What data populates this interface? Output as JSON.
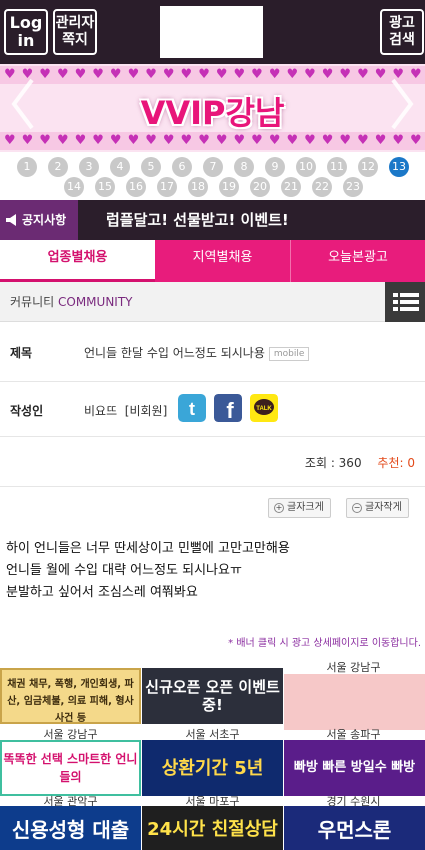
{
  "header": {
    "login_label": "Log\nin",
    "admin_label": "관리자\n쪽지",
    "search_label": "광고\n검색"
  },
  "banner": {
    "title": "VVIP강남",
    "heart_icon": "heart-icon"
  },
  "pagination": {
    "pages": [
      "1",
      "2",
      "3",
      "4",
      "5",
      "6",
      "7",
      "8",
      "9",
      "10",
      "11",
      "12",
      "13",
      "14",
      "15",
      "16",
      "17",
      "18",
      "19",
      "20",
      "21",
      "22",
      "23"
    ],
    "active": "13"
  },
  "notice": {
    "label": "공지사항",
    "text": "럽플달고! 선물받고! 이벤트!"
  },
  "tabs": [
    "업종별채용",
    "지역별채용",
    "오늘본광고"
  ],
  "community": {
    "title_ko": "커뮤니티",
    "title_en": "COMMUNITY"
  },
  "post": {
    "subject_label": "제목",
    "subject": "언니들 한달 수입 어느정도 되시나용",
    "mobile_badge": "mobile",
    "author_label": "작성인",
    "author": "비요뜨",
    "author_type": "[비회원]",
    "views_label": "조회 : 360",
    "recommend_label": "추천: 0",
    "font_larger": "글자크게",
    "font_smaller": "글자작게",
    "body_lines": [
      "하이 언니들은 너무 딴세상이고 민뻘에 고만고만해용",
      "언니들 월에 수입 대략 어느정도 되시나요ㅠ",
      "분발하고 싶어서 조심스레 여쭤봐요"
    ]
  },
  "banner_note": "* 배너 클릭 시 광고 상세페이지로 이동합니다.",
  "ads": {
    "captions_row0": [
      "",
      "",
      "서울 강남구"
    ],
    "row1": [
      {
        "text": "채권 채무, 폭행, 개인회생, 파산, 임금체불, 의료 피해, 형사사건 등",
        "bg": "#f4d98a"
      },
      {
        "text": "신규오픈 오픈 이벤트중!",
        "bg": "#2c2f3b"
      },
      {
        "text": "",
        "bg": "#f6c8c8"
      }
    ],
    "captions_row1": [
      "서울 강남구",
      "서울 서초구",
      "서울 송파구"
    ],
    "row2": [
      {
        "text": "똑똑한 선택 스마트한 언니들의",
        "bg": "#ffffff"
      },
      {
        "text": "상환기간 5년",
        "bg": "#0f2a6e"
      },
      {
        "text": "빠방 빠른 방일수 빠방",
        "bg": "#5a1d8a"
      }
    ],
    "captions_row2": [
      "서울 관악구",
      "서울 마포구",
      "경기 수원시"
    ],
    "row3": [
      {
        "text": "신용성형 대출",
        "bg": "#0d3c8c"
      },
      {
        "text": "24시간 친절상담",
        "bg": "#1f1f1f"
      },
      {
        "text": "우먼스론",
        "bg": "#1b2a7a"
      }
    ]
  }
}
